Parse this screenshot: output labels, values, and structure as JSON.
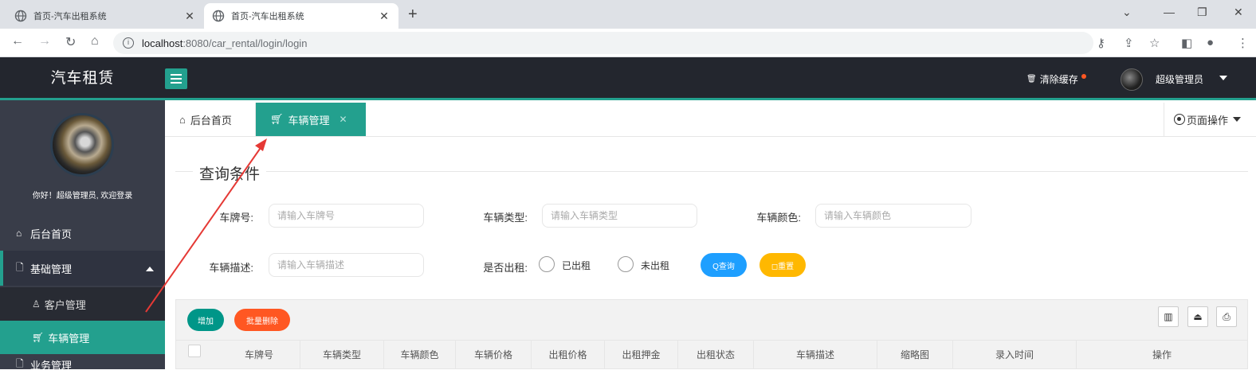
{
  "browser": {
    "tabs": [
      {
        "title": "首页-汽车出租系统",
        "active": false
      },
      {
        "title": "首页-汽车出租系统",
        "active": true
      }
    ],
    "url_host": "localhost",
    "url_path": ":8080/car_rental/login/login"
  },
  "header": {
    "logo": "汽车租赁",
    "clear_cache": "清除缓存",
    "user_name": "超级管理员"
  },
  "sidebar": {
    "welcome": "你好！超级管理员, 欢迎登录",
    "items": [
      {
        "label": "后台首页",
        "icon": "home-icon"
      },
      {
        "label": "基础管理",
        "icon": "document-icon",
        "expanded": true
      },
      {
        "label": "客户管理",
        "icon": "user-icon"
      },
      {
        "label": "车辆管理",
        "icon": "cart-icon",
        "selected": true
      },
      {
        "label": "业务管理",
        "icon": "document-icon"
      }
    ]
  },
  "content_tabs": [
    {
      "label": "后台首页",
      "icon": "home-icon"
    },
    {
      "label": "车辆管理",
      "icon": "cart-icon",
      "active": true
    }
  ],
  "page_ops": "页面操作",
  "query": {
    "legend": "查询条件",
    "plate_label": "车牌号:",
    "plate_placeholder": "请输入车牌号",
    "type_label": "车辆类型:",
    "type_placeholder": "请输入车辆类型",
    "color_label": "车辆颜色:",
    "color_placeholder": "请输入车辆颜色",
    "desc_label": "车辆描述:",
    "desc_placeholder": "请输入车辆描述",
    "rented_label": "是否出租:",
    "rented_yes": "已出租",
    "rented_no": "未出租",
    "search_btn": "Q查询",
    "reset_btn": "◻重置"
  },
  "table": {
    "add_btn": "增加",
    "batch_delete_btn": "批量删除",
    "columns": [
      "车牌号",
      "车辆类型",
      "车辆颜色",
      "车辆价格",
      "出租价格",
      "出租押金",
      "出租状态",
      "车辆描述",
      "缩略图",
      "录入时间",
      "操作"
    ]
  },
  "colors": {
    "primary": "#23a08e",
    "header_bg": "#23262e",
    "sidebar_bg": "#393d49",
    "search": "#1e9fff",
    "reset": "#ffb800",
    "danger": "#ff5722",
    "annotation": "#e53935"
  }
}
